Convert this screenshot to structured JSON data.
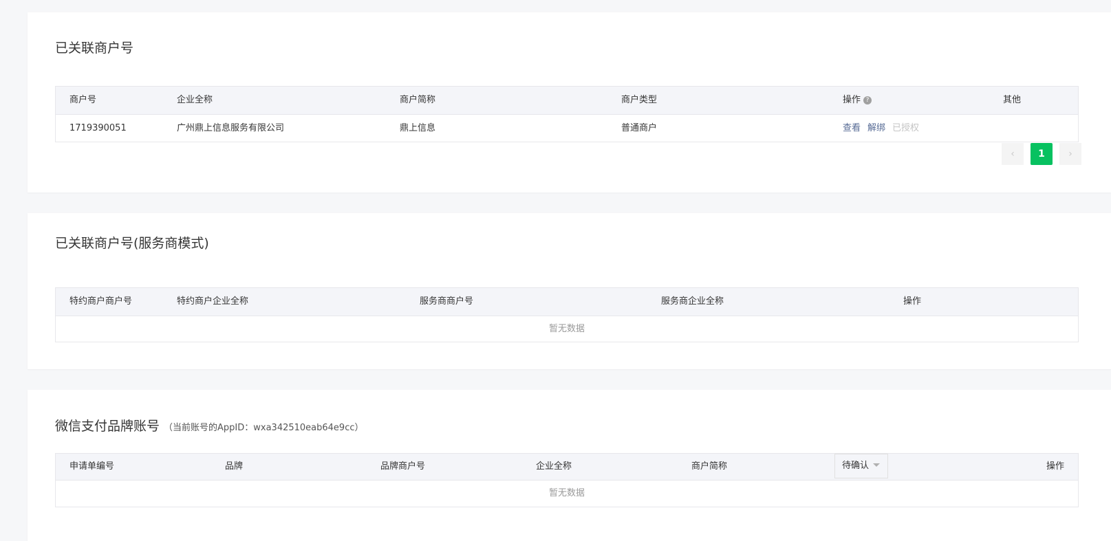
{
  "section1": {
    "title": "已关联商户号",
    "columns": {
      "merchant_no": "商户号",
      "company_name": "企业全称",
      "short_name": "商户简称",
      "merchant_type": "商户类型",
      "actions": "操作",
      "other": "其他"
    },
    "rows": [
      {
        "merchant_no": "1719390051",
        "company_name": "广州鼎上信息服务有限公司",
        "short_name": "鼎上信息",
        "merchant_type": "普通商户",
        "action_view": "查看",
        "action_unbind": "解绑",
        "action_authorized": "已授权"
      }
    ],
    "pagination": {
      "prev": "‹",
      "current": "1",
      "next": "›"
    }
  },
  "section2": {
    "title": "已关联商户号(服务商模式)",
    "columns": {
      "sub_merchant_no": "特约商户商户号",
      "sub_company_name": "特约商户企业全称",
      "sp_merchant_no": "服务商商户号",
      "sp_company_name": "服务商企业全称",
      "actions": "操作"
    },
    "empty_text": "暂无数据"
  },
  "section3": {
    "title": "微信支付品牌账号",
    "subtitle": "（当前账号的AppID：wxa342510eab64e9cc）",
    "columns": {
      "application_no": "申请单编号",
      "brand": "品牌",
      "brand_merchant_no": "品牌商户号",
      "company_name": "企业全称",
      "short_name": "商户简称",
      "status_filter": "待确认",
      "actions": "操作"
    },
    "empty_text": "暂无数据"
  },
  "colors": {
    "page_bg": "#f6f7f9",
    "accent_green": "#07c160",
    "link": "#576b95",
    "header_bg": "#f4f5f9"
  }
}
